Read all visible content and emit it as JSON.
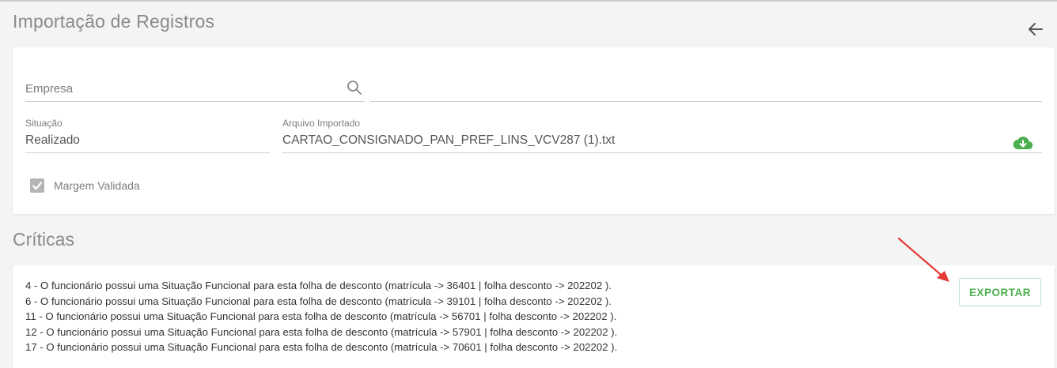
{
  "page": {
    "title": "Importação de Registros"
  },
  "form": {
    "empresa": {
      "placeholder": "Empresa",
      "value": ""
    },
    "situacao": {
      "label": "Situação",
      "value": "Realizado"
    },
    "arquivo": {
      "label": "Arquivo Importado",
      "value": "CARTAO_CONSIGNADO_PAN_PREF_LINS_VCV287 (1).txt"
    },
    "margem": {
      "label": "Margem Validada",
      "checked": true
    }
  },
  "criticas": {
    "title": "Críticas",
    "export_label": "EXPORTAR",
    "messages": [
      "4 - O funcionário possui uma Situação Funcional para esta folha de desconto (matrícula -> 36401 | folha desconto -> 202202 ).",
      "6 - O funcionário possui uma Situação Funcional para esta folha de desconto (matrícula -> 39101 | folha desconto -> 202202 ).",
      "11 - O funcionário possui uma Situação Funcional para esta folha de desconto (matrícula -> 56701 | folha desconto -> 202202 ).",
      "12 - O funcionário possui uma Situação Funcional para esta folha de desconto (matrícula -> 57901 | folha desconto -> 202202 ).",
      "17 - O funcionário possui uma Situação Funcional para esta folha de desconto (matrícula -> 70601 | folha desconto -> 202202 )."
    ]
  },
  "icons": {
    "back": "arrow-left-icon",
    "search": "search-icon",
    "download": "cloud-download-icon",
    "check": "check-icon"
  },
  "colors": {
    "accent_green": "#4caf50",
    "annotation_red": "#e53935",
    "title_gray": "#8a8a8a"
  }
}
